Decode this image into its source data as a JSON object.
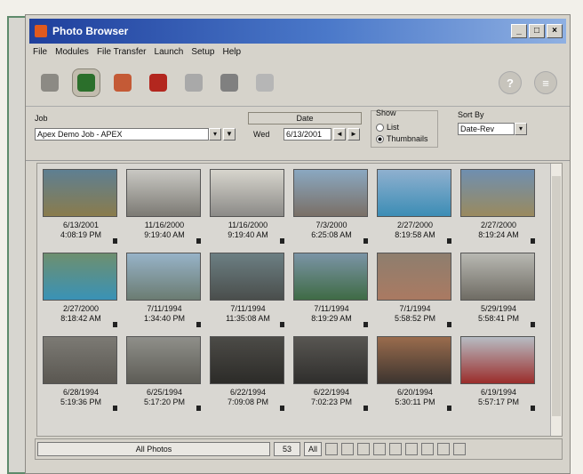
{
  "window": {
    "title": "Photo Browser"
  },
  "menu": [
    "File",
    "Modules",
    "File Transfer",
    "Launch",
    "Setup",
    "Help"
  ],
  "toolbar": {
    "icons": [
      {
        "name": "modules-icon",
        "color": "#8c8a84"
      },
      {
        "name": "photo-browser-icon",
        "color": "#2b6f2b"
      },
      {
        "name": "globe-icon",
        "color": "#c45a36"
      },
      {
        "name": "book-icon",
        "color": "#b3271f"
      },
      {
        "name": "scanner-icon",
        "color": "#a9a9a9"
      },
      {
        "name": "printer-icon",
        "color": "#808080"
      },
      {
        "name": "disk-icon",
        "color": "#b6b6b6"
      }
    ]
  },
  "controls": {
    "job_label": "Job",
    "job_value": "Apex Demo Job - APEX",
    "date_label": "Date",
    "wed_label": "Wed",
    "date_value": "6/13/2001",
    "show_label": "Show",
    "list_label": "List",
    "thumbnails_label": "Thumbnails",
    "sort_label": "Sort By",
    "sort_value": "Date-Rev"
  },
  "photos": [
    {
      "date": "6/13/2001",
      "time": "4:08:19 PM",
      "c1": "#5e7f92",
      "c2": "#8a7c4c"
    },
    {
      "date": "11/16/2000",
      "time": "9:19:40 AM",
      "c1": "#c9c8c3",
      "c2": "#7c7a74"
    },
    {
      "date": "11/16/2000",
      "time": "9:19:40 AM",
      "c1": "#d7d5cd",
      "c2": "#8b8a87"
    },
    {
      "date": "7/3/2000",
      "time": "6:25:08 AM",
      "c1": "#8aa8c1",
      "c2": "#7a6f66"
    },
    {
      "date": "2/27/2000",
      "time": "8:19:58 AM",
      "c1": "#8fb0cf",
      "c2": "#3c8db5"
    },
    {
      "date": "2/27/2000",
      "time": "8:19:24 AM",
      "c1": "#6f8fb0",
      "c2": "#9a8a5e"
    },
    {
      "date": "2/27/2000",
      "time": "8:18:42 AM",
      "c1": "#6e8f6f",
      "c2": "#3a92b6"
    },
    {
      "date": "7/11/1994",
      "time": "1:34:40 PM",
      "c1": "#97b3c8",
      "c2": "#6b7c72"
    },
    {
      "date": "7/11/1994",
      "time": "11:35:08 AM",
      "c1": "#6c7f83",
      "c2": "#4a4e4c"
    },
    {
      "date": "7/11/1994",
      "time": "8:19:29 AM",
      "c1": "#7b94a6",
      "c2": "#3f6b45"
    },
    {
      "date": "7/1/1994",
      "time": "5:58:52 PM",
      "c1": "#8e7e6e",
      "c2": "#aa7a62"
    },
    {
      "date": "5/29/1994",
      "time": "5:58:41 PM",
      "c1": "#b8b8b2",
      "c2": "#6f6c64"
    },
    {
      "date": "6/28/1994",
      "time": "5:19:36 PM",
      "c1": "#7c7a74",
      "c2": "#5a5751"
    },
    {
      "date": "6/25/1994",
      "time": "5:17:20 PM",
      "c1": "#8f8f8a",
      "c2": "#5d5c56"
    },
    {
      "date": "6/22/1994",
      "time": "7:09:08 PM",
      "c1": "#4c4b47",
      "c2": "#2c2b28"
    },
    {
      "date": "6/22/1994",
      "time": "7:02:23 PM",
      "c1": "#585652",
      "c2": "#2f2e2c"
    },
    {
      "date": "6/20/1994",
      "time": "5:30:11 PM",
      "c1": "#9a6c4d",
      "c2": "#3c342f"
    },
    {
      "date": "6/19/1994",
      "time": "5:57:17 PM",
      "c1": "#b7bcc3",
      "c2": "#9b2d2b"
    }
  ],
  "status": {
    "filter": "All Photos",
    "count": "53",
    "all_label": "All"
  }
}
